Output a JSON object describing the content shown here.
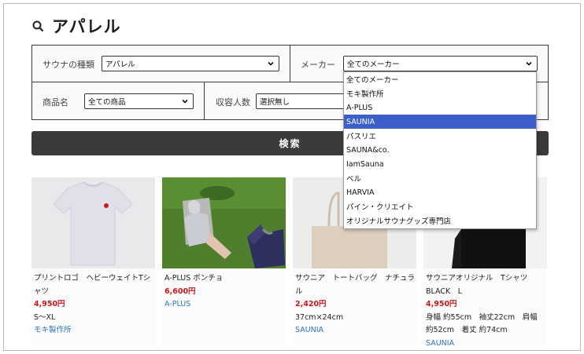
{
  "page_title": "アパレル",
  "filters": {
    "sauna_type_label": "サウナの種類",
    "sauna_type_value": "アパレル",
    "maker_label": "メーカー",
    "maker_value": "全てのメーカー",
    "product_label": "商品名",
    "product_value": "全ての商品",
    "capacity_label": "収容人数",
    "capacity_value": "選択無し"
  },
  "maker_options": [
    {
      "label": "全てのメーカー"
    },
    {
      "label": "モキ製作所"
    },
    {
      "label": "A-PLUS"
    },
    {
      "label": "SAUNIA",
      "highlighted": true
    },
    {
      "label": "パスリエ"
    },
    {
      "label": "SAUNA&co."
    },
    {
      "label": "IamSauna"
    },
    {
      "label": "ベル"
    },
    {
      "label": "HARVIA"
    },
    {
      "label": "パイン・クリエイト"
    },
    {
      "label": "オリジナルサウナグッズ専門店"
    }
  ],
  "search_button": "検索",
  "products": [
    {
      "name": "プリントロゴ　ヘビーウェイトTシャツ",
      "price": "4,950円",
      "spec": "S～XL",
      "maker": "モキ製作所"
    },
    {
      "name": "A-PLUS ポンチョ",
      "price": "6,600円",
      "spec": "",
      "maker": "A-PLUS"
    },
    {
      "name": "サウニア　トートバッグ　ナチュラル",
      "price": "2,420円",
      "spec": "37cm×24cm",
      "maker": "SAUNIA"
    },
    {
      "name": "サウニアオリジナル　Tシャツ　BLACK　L",
      "price": "4,950円",
      "spec": "身幅 約55cm　袖丈22cm　肩幅 約52cm　着丈 約74cm",
      "maker": "SAUNIA"
    }
  ],
  "colors": {
    "accent": "#3d5fc9",
    "price": "#c8181e",
    "maker_link": "#2f74c0",
    "button_bg": "#3b3b3b"
  }
}
